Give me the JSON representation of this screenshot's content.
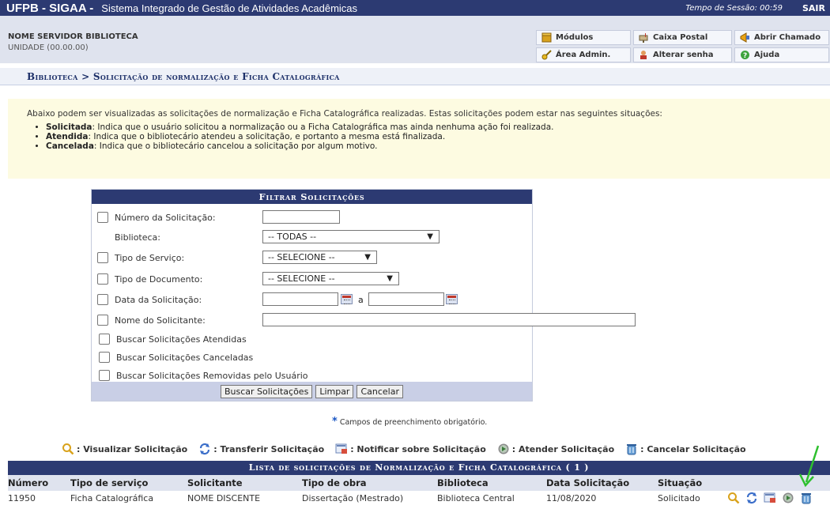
{
  "topbar": {
    "brand": "UFPB - SIGAA -",
    "system_name": "Sistema Integrado de Gestão de Atividades Acadêmicas",
    "session_label": "Tempo de Sessão: 00:59",
    "logout": "SAIR"
  },
  "user": {
    "name": "NOME SERVIDOR BIBLIOTECA",
    "unit": "UNIDADE (00.00.00)"
  },
  "menu": {
    "modulos": "Módulos",
    "caixa_postal": "Caixa Postal",
    "abrir_chamado": "Abrir Chamado",
    "area_admin": "Área Admin.",
    "alterar_senha": "Alterar senha",
    "ajuda": "Ajuda"
  },
  "breadcrumb": "Biblioteca > Solicitação de normalização e Ficha Catalográfica",
  "info": {
    "intro": "Abaixo podem ser visualizadas as solicitações de normalização e Ficha Catalográfica realizadas. Estas solicitações podem estar nas seguintes situações:",
    "items": [
      {
        "term": "Solicitada",
        "desc": ": Indica que o usuário solicitou a normalização ou a Ficha Catalográfica mas ainda nenhuma ação foi realizada."
      },
      {
        "term": "Atendida",
        "desc": ": Indica que o bibliotecário atendeu a solicitação, e portanto a mesma está finalizada."
      },
      {
        "term": "Cancelada",
        "desc": ": Indica que o bibliotecário cancelou a solicitação por algum motivo."
      }
    ]
  },
  "filter": {
    "title": "Filtrar Solicitações",
    "numero_label": "Número da Solicitação:",
    "numero_value": "",
    "biblioteca_label": "Biblioteca:",
    "biblioteca_value": "-- TODAS --",
    "tipo_servico_label": "Tipo de Serviço:",
    "tipo_servico_value": "-- SELECIONE --",
    "tipo_documento_label": "Tipo de Documento:",
    "tipo_documento_value": "-- SELECIONE --",
    "data_label": "Data da Solicitação:",
    "data_sep": "a",
    "data_inicio": "",
    "data_fim": "",
    "nome_label": "Nome do Solicitante:",
    "nome_value": "",
    "atendidas_label": "Buscar Solicitações Atendidas",
    "canceladas_label": "Buscar Solicitações Canceladas",
    "removidas_label": "Buscar Solicitações Removidas pelo Usuário",
    "buscar_button": "Buscar Solicitações",
    "limpar_button": "Limpar",
    "cancelar_button": "Cancelar"
  },
  "required_note": "Campos de preenchimento obrigatório.",
  "legend": {
    "visualizar": ": Visualizar Solicitação",
    "transferir": ": Transferir Solicitação",
    "notificar": ": Notificar sobre Solicitação",
    "atender": ": Atender Solicitação",
    "cancelar": ": Cancelar Solicitação"
  },
  "list": {
    "title": "Lista de solicitações de Normalização e Ficha Catalográfica ( 1 )",
    "columns": [
      "Número",
      "Tipo de serviço",
      "Solicitante",
      "Tipo de obra",
      "Biblioteca",
      "Data Solicitação",
      "Situação"
    ],
    "rows": [
      [
        "11950",
        "Ficha Catalográfica",
        "NOME DISCENTE",
        "Dissertação (Mestrado)",
        "Biblioteca Central",
        "11/08/2020",
        "Solicitado"
      ]
    ]
  },
  "colors": {
    "header_navy": "#2c3a72",
    "info_bg": "#fdfbe1",
    "row_header_bg": "#dfe3ee",
    "annotation_arrow": "#2ec02e"
  }
}
